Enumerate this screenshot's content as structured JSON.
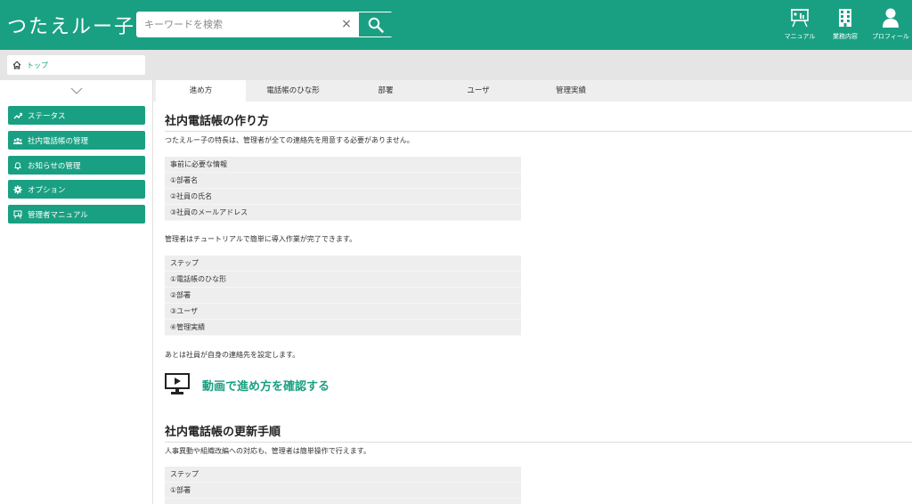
{
  "header": {
    "logo": "つたえルー子",
    "search_placeholder": "キーワードを検索",
    "clear_label": "×",
    "nav": [
      {
        "label": "マニュアル",
        "icon": "presentation-icon"
      },
      {
        "label": "業務内容",
        "icon": "building-icon"
      },
      {
        "label": "プロフィール",
        "icon": "user-icon"
      }
    ]
  },
  "breadcrumb": {
    "home_label": "トップ"
  },
  "sidebar": {
    "items": [
      {
        "label": "ステータス",
        "icon": "chart-icon"
      },
      {
        "label": "社内電話帳の管理",
        "icon": "people-icon"
      },
      {
        "label": "お知らせの管理",
        "icon": "bell-icon"
      },
      {
        "label": "オプション",
        "icon": "gear-icon"
      },
      {
        "label": "管理者マニュアル",
        "icon": "presentation-icon"
      }
    ]
  },
  "tabs": [
    {
      "label": "進め方",
      "active": true
    },
    {
      "label": "電話帳のひな形"
    },
    {
      "label": "部署"
    },
    {
      "label": "ユーザ"
    },
    {
      "label": "管理実績"
    }
  ],
  "section1": {
    "title": "社内電話帳の作り方",
    "intro": "つたえルー子の特長は、管理者が全ての連絡先を用意する必要がありません。",
    "box1": [
      "事前に必要な情報",
      "①部署名",
      "②社員の氏名",
      "③社員のメールアドレス"
    ],
    "text2": "管理者はチュートリアルで簡単に導入作業が完了できます。",
    "box2": [
      "ステップ",
      "①電話帳のひな形",
      "②部署",
      "③ユーザ",
      "④管理実績"
    ],
    "text3": "あとは社員が自身の連絡先を設定します。",
    "video_label": "動画で進め方を確認する"
  },
  "section2": {
    "title": "社内電話帳の更新手順",
    "intro": "人事異動や組織改編への対応も、管理者は簡単操作で行えます。",
    "box": [
      "ステップ",
      "①部署"
    ]
  },
  "colors": {
    "brand": "#19a082",
    "tab_bg": "#eeeeee",
    "box_bg": "#eeeeee"
  }
}
